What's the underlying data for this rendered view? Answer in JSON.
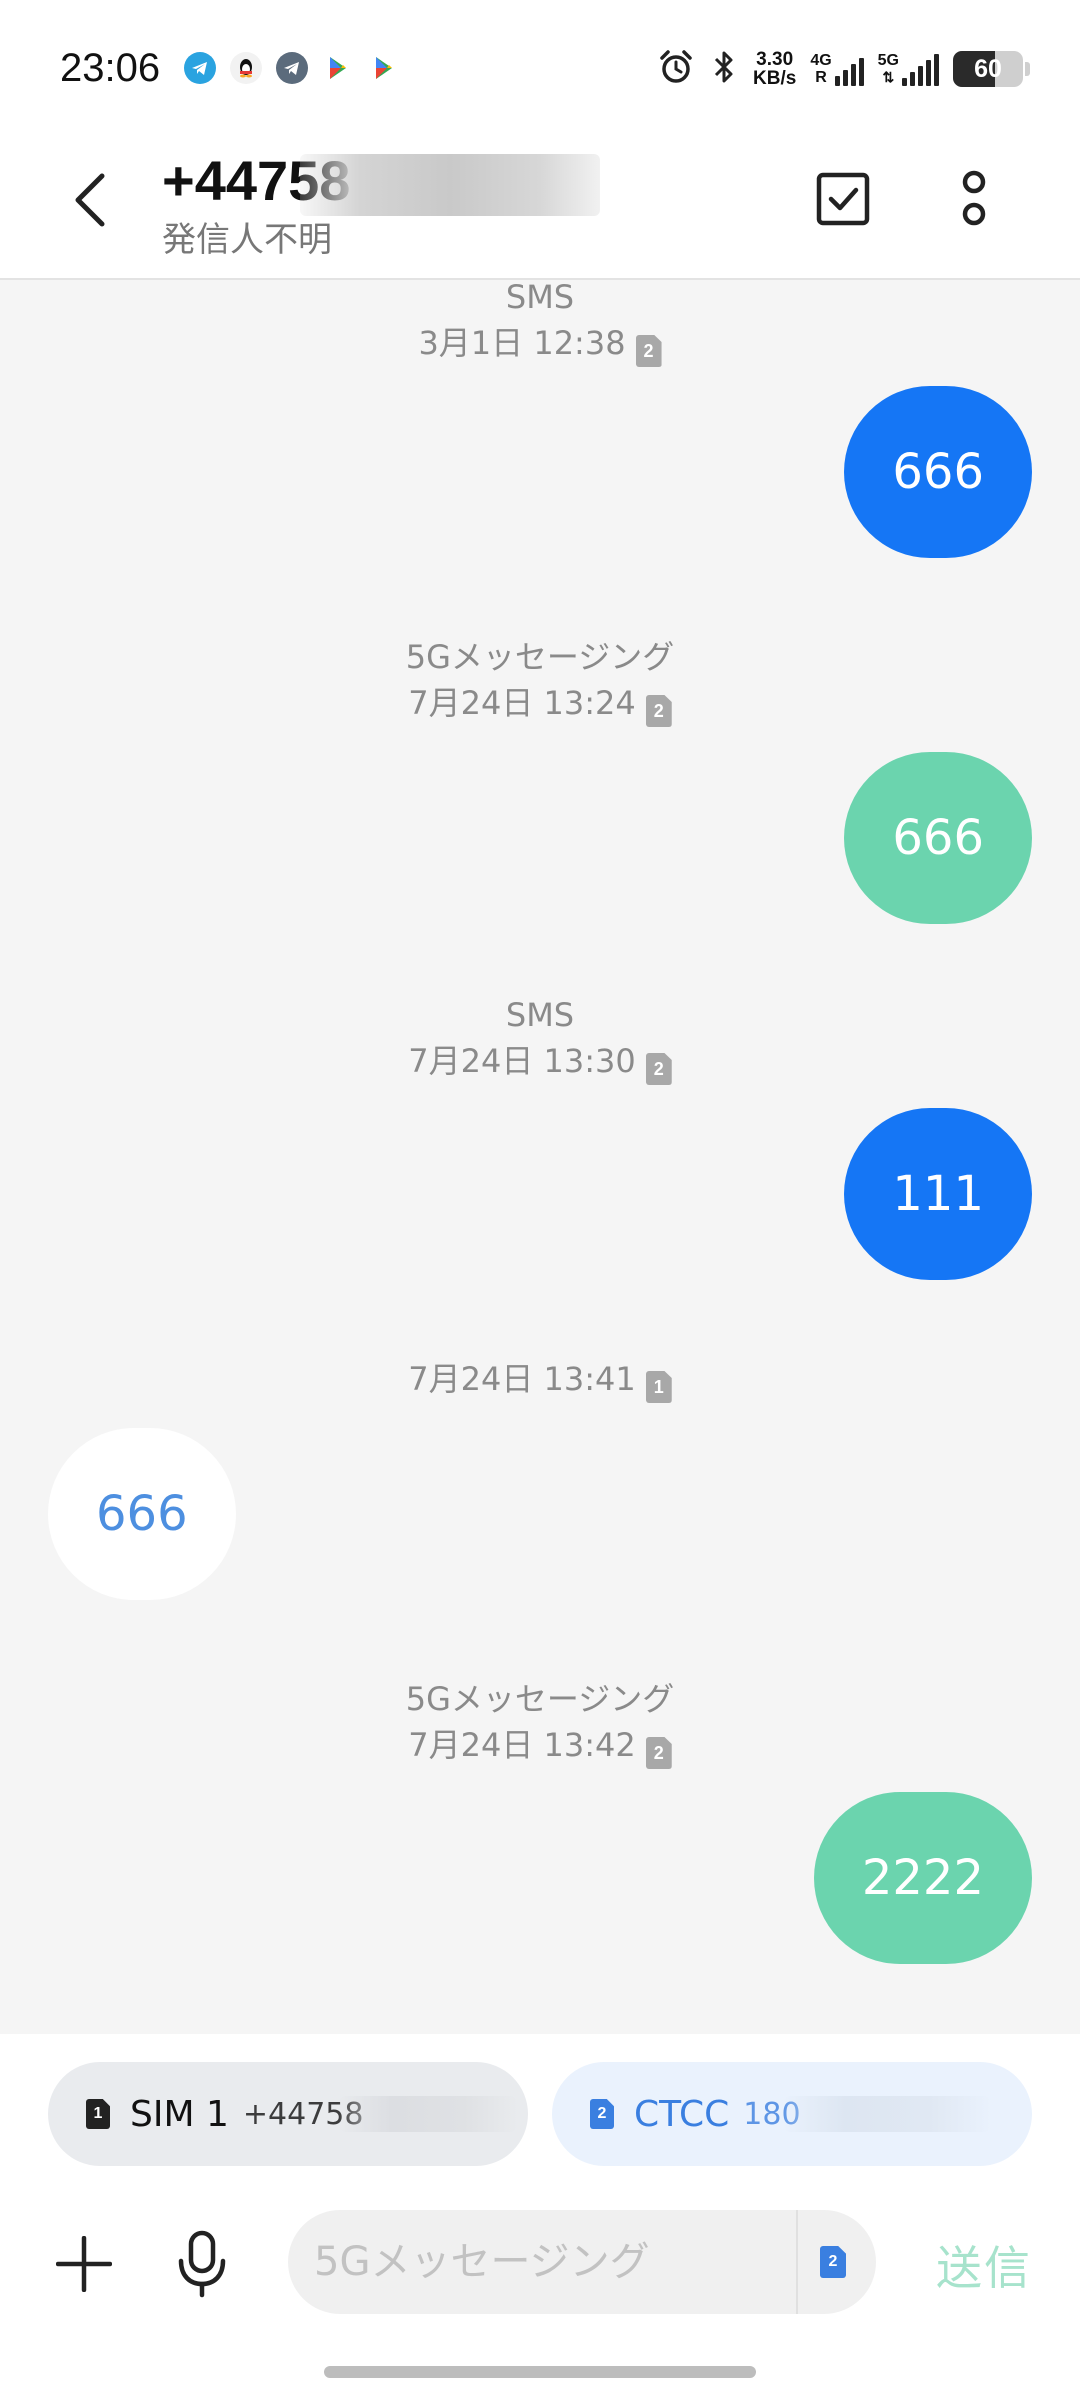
{
  "status_bar": {
    "time": "23:06",
    "net_speed_value": "3.30",
    "net_speed_unit": "KB/s",
    "sim1_network": "4G",
    "sim1_roaming": "R",
    "sim2_network": "5G",
    "battery": "60",
    "battery_level": 0.6,
    "notification_icons": [
      "telegram-icon",
      "qq-icon",
      "telegram-icon",
      "play-store-icon",
      "play-store-icon"
    ]
  },
  "header": {
    "contact_number": "+44758",
    "contact_status": "発信人不明"
  },
  "messages": [
    {
      "service": "SMS",
      "timestamp": "3月1日 12:38",
      "sim": "2",
      "direction": "out",
      "text": "666"
    },
    {
      "service": "5Gメッセージング",
      "timestamp": "7月24日 13:24",
      "sim": "2",
      "direction": "out",
      "text": "666"
    },
    {
      "service": "SMS",
      "timestamp": "7月24日 13:30",
      "sim": "2",
      "direction": "out",
      "text": "111"
    },
    {
      "service": "",
      "timestamp": "7月24日 13:41",
      "sim": "1",
      "direction": "in",
      "text": "666"
    },
    {
      "service": "5Gメッセージング",
      "timestamp": "7月24日 13:42",
      "sim": "2",
      "direction": "out",
      "text": "2222"
    }
  ],
  "sim_selector": {
    "sim1": {
      "index": "1",
      "name": "SIM 1",
      "number": "+44758"
    },
    "sim2": {
      "index": "2",
      "name": "CTCC",
      "number": "180"
    }
  },
  "compose": {
    "placeholder": "5Gメッセージング",
    "sim": "2",
    "send_label": "送信"
  },
  "colors": {
    "sms_bubble": "#1576f5",
    "rcs_bubble": "#6bd4ae",
    "incoming_text": "#4d8fe0",
    "send_disabled": "#a7e3cc"
  }
}
